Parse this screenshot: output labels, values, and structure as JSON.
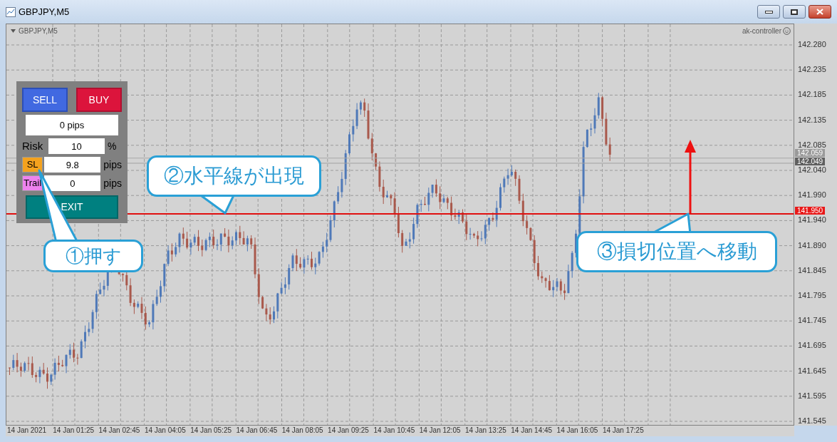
{
  "window": {
    "title": "GBPJPY,M5"
  },
  "chart": {
    "symbol_label": "GBPJPY,M5",
    "indicator_label": "ak-controller",
    "price_ticks": [
      "142.280",
      "142.235",
      "142.185",
      "142.135",
      "142.085",
      "142.040",
      "141.990",
      "141.940",
      "141.890",
      "141.845",
      "141.795",
      "141.745",
      "141.695",
      "141.645",
      "141.595",
      "141.545"
    ],
    "time_ticks": [
      "14 Jan 2021",
      "14 Jan 01:25",
      "14 Jan 02:45",
      "14 Jan 04:05",
      "14 Jan 05:25",
      "14 Jan 06:45",
      "14 Jan 08:05",
      "14 Jan 09:25",
      "14 Jan 10:45",
      "14 Jan 12:05",
      "14 Jan 13:25",
      "14 Jan 14:45",
      "14 Jan 16:05",
      "14 Jan 17:25"
    ],
    "price_markers": [
      {
        "label": "142.059",
        "kind": "ask"
      },
      {
        "label": "142.049",
        "kind": "bid"
      },
      {
        "label": "141.950",
        "kind": "stop"
      }
    ]
  },
  "panel": {
    "sell": "SELL",
    "buy": "BUY",
    "profit": "0 pips",
    "exit": "EXIT",
    "rows": [
      {
        "kind": "text",
        "label": "Risk",
        "value": "10",
        "unit": "%"
      },
      {
        "kind": "button",
        "label": "SL",
        "color": "#f4a21e",
        "value": "9.8",
        "unit": "pips"
      },
      {
        "kind": "button",
        "label": "Trail",
        "color": "#ee82ee",
        "value": "0",
        "unit": "pips"
      }
    ]
  },
  "callouts": [
    {
      "text": "①押す",
      "kind": "press"
    },
    {
      "text": "②水平線が出現",
      "kind": "line"
    },
    {
      "text": "③損切位置へ移動",
      "kind": "move"
    }
  ]
}
